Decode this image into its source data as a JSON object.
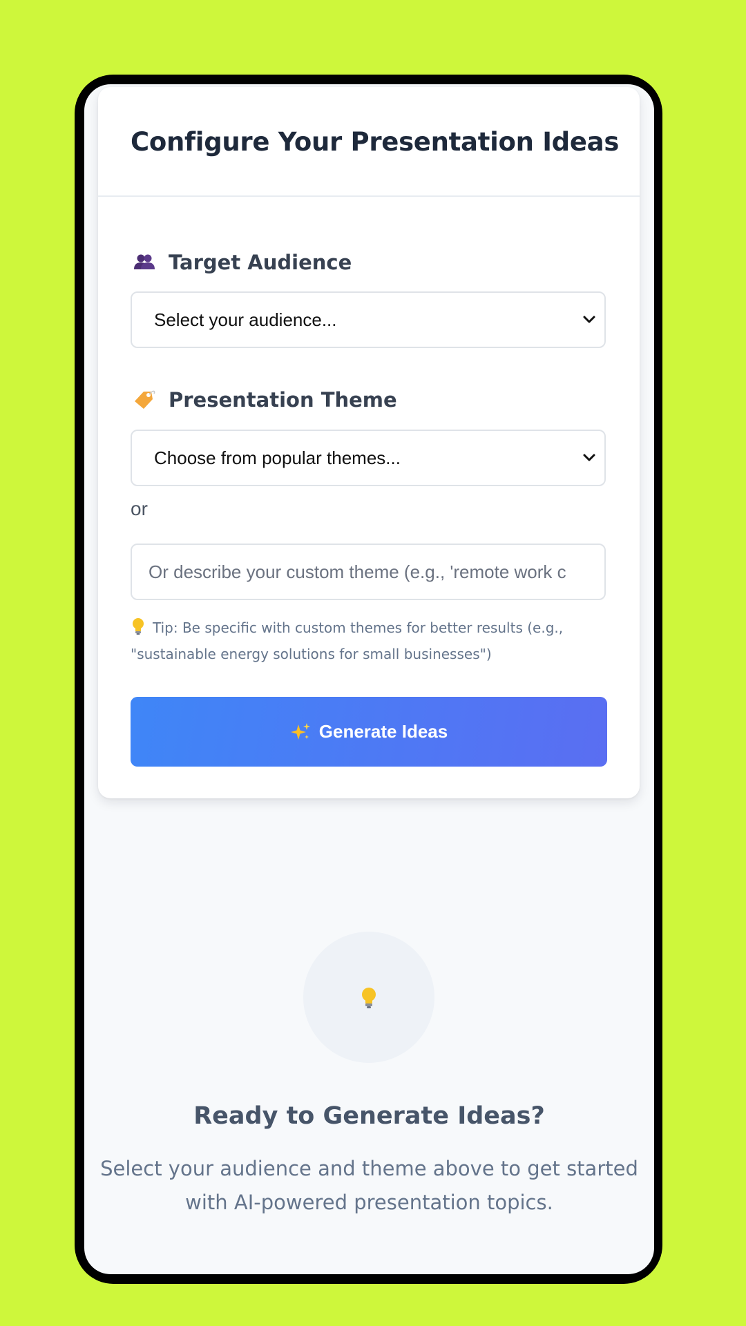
{
  "card": {
    "title": "Configure Your Presentation Ideas"
  },
  "audience": {
    "label": "Target Audience",
    "icon": "people-icon",
    "selected": "Select your audience..."
  },
  "theme": {
    "label": "Presentation Theme",
    "icon": "tag-icon",
    "selected": "Choose from popular themes...",
    "or_text": "or",
    "custom_placeholder": "Or describe your custom theme (e.g., 'remote work c"
  },
  "tip": {
    "icon": "lightbulb-icon",
    "text": "Tip: Be specific with custom themes for better results (e.g., \"sustainable energy solutions for small businesses\")"
  },
  "generate_button": {
    "icon": "sparkles-icon",
    "label": "Generate Ideas"
  },
  "empty_state": {
    "icon": "lightbulb-icon",
    "title": "Ready to Generate Ideas?",
    "description": "Select your audience and theme above to get started with AI-powered presentation topics."
  },
  "colors": {
    "background": "#cef73b",
    "button_gradient_start": "#3f86f7",
    "button_gradient_end": "#5a6ef2",
    "heading": "#1e293b"
  }
}
